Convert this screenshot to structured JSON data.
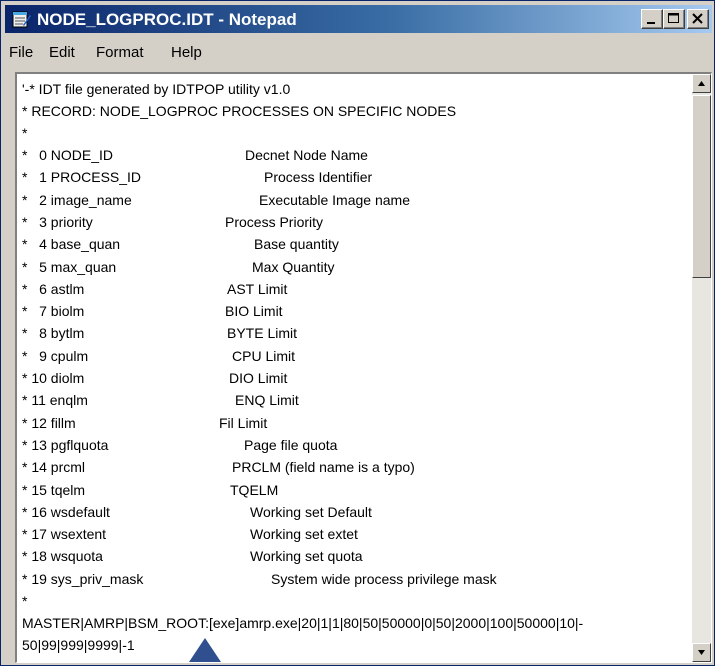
{
  "window": {
    "title": "NODE_LOGPROC.IDT - Notepad",
    "icon": "notepad-icon"
  },
  "menu": [
    "File",
    "Edit",
    "Format",
    "Help"
  ],
  "content": {
    "header_lines": [
      "'-* IDT file generated by IDTPOP utility v1.0",
      "* RECORD: NODE_LOGPROC PROCESSES ON SPECIFIC NODES",
      "*"
    ],
    "fields": [
      {
        "prefix": "*   0 NODE_ID",
        "desc": "Decnet Node Name"
      },
      {
        "prefix": "*   1 PROCESS_ID",
        "desc": "Process Identifier"
      },
      {
        "prefix": "*   2 image_name",
        "desc": "Executable Image name"
      },
      {
        "prefix": "*   3 priority",
        "desc": "Process Priority"
      },
      {
        "prefix": "*   4 base_quan",
        "desc": "Base quantity"
      },
      {
        "prefix": "*   5 max_quan",
        "desc": "Max Quantity"
      },
      {
        "prefix": "*   6 astlm",
        "desc": "AST Limit"
      },
      {
        "prefix": "*   7 biolm",
        "desc": "BIO Limit"
      },
      {
        "prefix": "*   8 bytlm",
        "desc": "BYTE Limit"
      },
      {
        "prefix": "*   9 cpulm",
        "desc": "CPU Limit"
      },
      {
        "prefix": "* 10 diolm",
        "desc": "DIO Limit"
      },
      {
        "prefix": "* 11 enqlm",
        "desc": "ENQ Limit"
      },
      {
        "prefix": "* 12 fillm",
        "desc": "Fil Limit"
      },
      {
        "prefix": "* 13 pgflquota",
        "desc": "Page file quota"
      },
      {
        "prefix": "* 14 prcml",
        "desc": "PRCLM (field name is a typo)"
      },
      {
        "prefix": "* 15 tqelm",
        "desc": "TQELM"
      },
      {
        "prefix": "* 16 wsdefault",
        "desc": "Working set Default"
      },
      {
        "prefix": "* 17 wsextent",
        "desc": "Working set extet"
      },
      {
        "prefix": "* 18 wsquota",
        "desc": "Working set quota"
      },
      {
        "prefix": "* 19 sys_priv_mask",
        "desc": "System wide process privilege mask"
      }
    ],
    "trailer_lines": [
      "*",
      "MASTER|AMRP|BSM_ROOT:[exe]amrp.exe|20|1|1|80|50|50000|0|50|2000|100|50000|10|-",
      "50|99|999|9999|-1"
    ]
  },
  "scrollbar": {
    "up": "scroll-up-arrow",
    "down": "scroll-down-arrow"
  }
}
